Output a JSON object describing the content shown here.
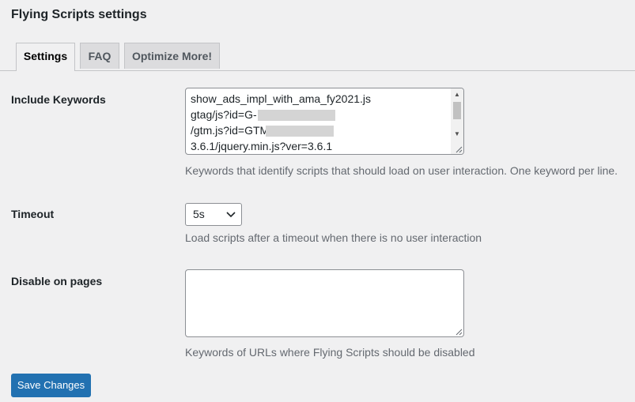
{
  "page": {
    "title": "Flying Scripts settings"
  },
  "tabs": [
    {
      "label": "Settings",
      "active": true
    },
    {
      "label": "FAQ",
      "active": false
    },
    {
      "label": "Optimize More!",
      "active": false
    }
  ],
  "include_keywords": {
    "label": "Include Keywords",
    "lines": [
      "show_ads_impl_with_ama_fy2021.js",
      "gtag/js?id=G-",
      "/gtm.js?id=GTM",
      "3.6.1/jquery.min.js?ver=3.6.1"
    ],
    "description": "Keywords that identify scripts that should load on user interaction. One keyword per line."
  },
  "timeout": {
    "label": "Timeout",
    "selected": "5s",
    "description": "Load scripts after a timeout when there is no user interaction"
  },
  "disable_on_pages": {
    "label": "Disable on pages",
    "value": "",
    "description": "Keywords of URLs where Flying Scripts should be disabled"
  },
  "save_button": {
    "label": "Save Changes"
  },
  "colors": {
    "background": "#f0f0f1",
    "primary_button": "#2271b1",
    "description_text": "#646970",
    "border": "#8c8f94"
  },
  "icons": {
    "select_chevron": "chevron-down-icon",
    "scroll_up": "scroll-up-arrow-icon",
    "scroll_down": "scroll-down-arrow-icon",
    "resize": "resize-grip-icon"
  }
}
